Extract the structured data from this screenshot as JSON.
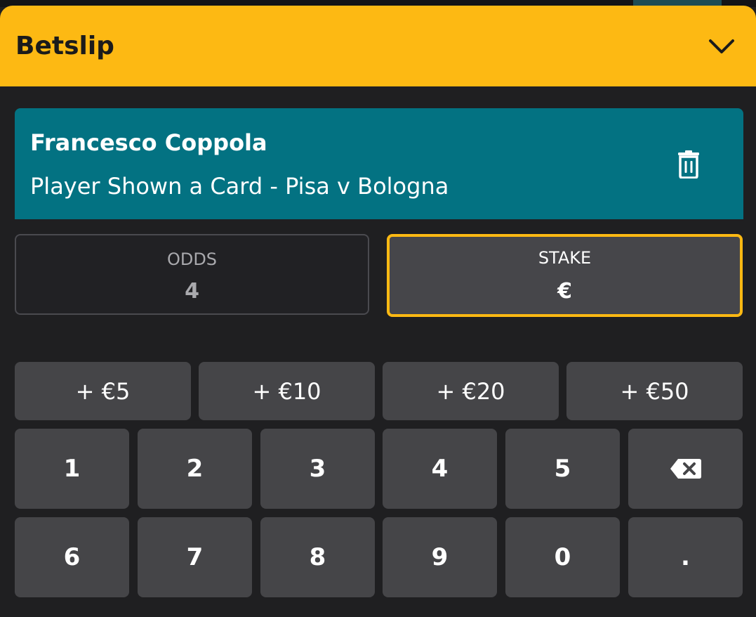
{
  "header": {
    "title": "Betslip",
    "collapse_icon": "chevron-down-icon"
  },
  "selection": {
    "name": "Francesco Coppola",
    "market": "Player Shown a Card - Pisa v Bologna",
    "delete_icon": "trash-icon"
  },
  "odds": {
    "label": "ODDS",
    "value": "4"
  },
  "stake": {
    "label": "STAKE",
    "currency": "€"
  },
  "quick_stakes": [
    "+ €5",
    "+ €10",
    "+ €20",
    "+ €50"
  ],
  "keypad": {
    "row1": [
      "1",
      "2",
      "3",
      "4",
      "5"
    ],
    "row2": [
      "6",
      "7",
      "8",
      "9",
      "0",
      "."
    ],
    "backspace_icon": "backspace-icon"
  },
  "colors": {
    "header_bg": "#fdb913",
    "selection_bg": "#037282",
    "page_bg": "#1f1f21",
    "key_bg": "#454548",
    "stake_border": "#fdb913"
  }
}
